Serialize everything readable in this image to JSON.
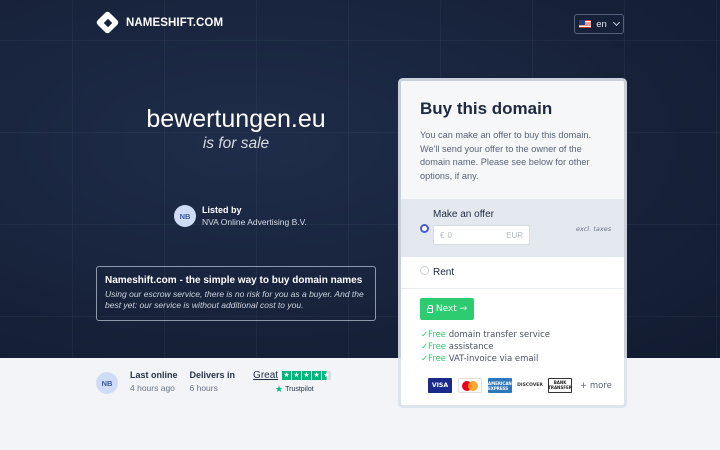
{
  "header": {
    "brand": "NAMESHIFT.COM",
    "language": "en"
  },
  "hero": {
    "domain": "bewertungen.eu",
    "tagline": "is for sale",
    "listed_by": {
      "avatar": "NB",
      "label": "Listed by",
      "value": "NVA Online Advertising B.V."
    },
    "info": {
      "title": "Nameshift.com - the simple way to buy domain names",
      "body": "Using our escrow service, there is no risk for you as a buyer. And the best yet: our service is without additional cost to you."
    }
  },
  "card": {
    "title": "Buy this domain",
    "description": "You can make an offer to buy this domain. We'll send your offer to the owner of the domain name. Please see below for other options, if any.",
    "offer": {
      "label": "Make an offer",
      "currency_symbol": "€",
      "placeholder": "0",
      "currency": "EUR",
      "tax_note": "excl. taxes",
      "selected": true
    },
    "rent": {
      "label": "Rent",
      "selected": false
    },
    "next_button": "Next →",
    "features": [
      {
        "free": "Free",
        "text": "domain transfer service"
      },
      {
        "free": "Free",
        "text": "assistance"
      },
      {
        "free": "Free",
        "text": "VAT-invoice via email"
      }
    ],
    "payments": {
      "visa": "VISA",
      "amex": "AMERICAN EXPRESS",
      "discover": "DISCOVER",
      "bank": "BANK TRANSFER",
      "more": "+ more"
    }
  },
  "bottom": {
    "avatar": "NB",
    "last_online_label": "Last online",
    "last_online_value": "4 hours ago",
    "delivers_label": "Delivers in",
    "delivers_value": "6 hours",
    "trustpilot": {
      "rating_word": "Great",
      "stars": 4.5,
      "brand": "Trustpilot"
    }
  },
  "colors": {
    "hero_bg": "#17223a",
    "accent_green": "#2ecc71",
    "radio_blue": "#4a5ad6",
    "trustpilot_green": "#00b67a"
  }
}
